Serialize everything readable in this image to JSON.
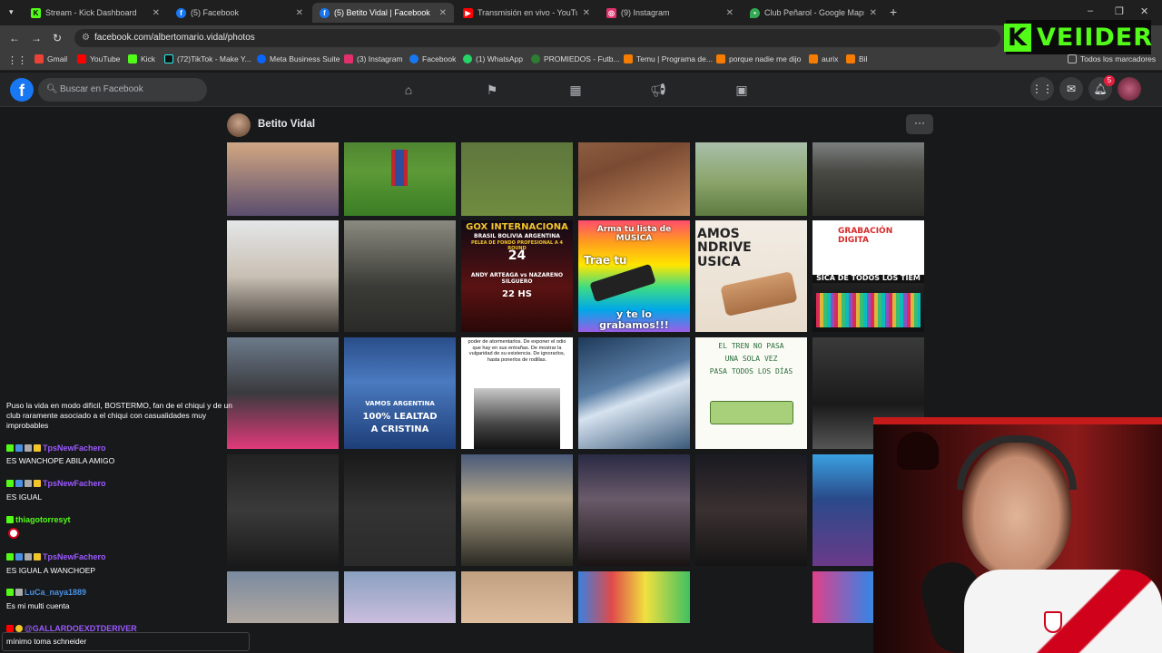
{
  "browser": {
    "tabs": [
      {
        "title": "Stream - Kick Dashboard",
        "favicon": "kick-icon",
        "color": "#53fc18",
        "active": false
      },
      {
        "title": "(5) Facebook",
        "favicon": "facebook-icon",
        "color": "#1877f2",
        "active": false
      },
      {
        "title": "(5) Betito Vidal | Facebook",
        "favicon": "facebook-icon",
        "color": "#1877f2",
        "active": true
      },
      {
        "title": "Transmisión en vivo - YouTube",
        "favicon": "youtube-icon",
        "color": "#ff0000",
        "active": false
      },
      {
        "title": "(9) Instagram",
        "favicon": "instagram-icon",
        "color": "#e1306c",
        "active": false
      },
      {
        "title": "Club Peñarol - Google Maps",
        "favicon": "maps-icon",
        "color": "#34a853",
        "active": false
      }
    ],
    "url": "facebook.com/albertomario.vidal/photos",
    "bookmarks": [
      {
        "label": "Gmail",
        "color": "#ea4335"
      },
      {
        "label": "YouTube",
        "color": "#ff0000"
      },
      {
        "label": "Kick",
        "color": "#53fc18"
      },
      {
        "label": "(72)TikTok - Make Y...",
        "color": "#25f4ee"
      },
      {
        "label": "Meta Business Suite",
        "color": "#0866ff"
      },
      {
        "label": "(3) Instagram",
        "color": "#e1306c"
      },
      {
        "label": "Facebook",
        "color": "#1877f2"
      },
      {
        "label": "(1) WhatsApp",
        "color": "#25d366"
      },
      {
        "label": "PROMIEDOS - Futb...",
        "color": "#2e7d32"
      },
      {
        "label": "Temu | Programa de...",
        "color": "#f57c00"
      },
      {
        "label": "porque nadie me dijo",
        "color": "#f57c00"
      },
      {
        "label": "aurix",
        "color": "#f57c00"
      },
      {
        "label": "Bil",
        "color": "#f57c00"
      }
    ],
    "all_bookmarks_label": "Todos los marcadores"
  },
  "kick_logo": "VEIIDER",
  "facebook": {
    "search_placeholder": "Buscar en Facebook",
    "notification_count": "5",
    "profile_name": "Betito Vidal",
    "photo_captions": {
      "boxing_title": "GOX INTERNACIONA",
      "boxing_sub": "BRASIL BOLIVIA ARGENTINA",
      "boxing_fight": "PELEA DE FONDO PROFESIONAL A 4 ROUND",
      "boxing_day": "24",
      "boxing_names": "ANDY ARTEAGA vs NAZARENO SILGUERO",
      "boxing_time": "22 HS",
      "music_title": "Arma tu lista de MUSICA",
      "music_trae": "Trae tu",
      "music_grab": "y te lo grabamos!!!",
      "pendrive_title": "AMOS NDRIVE USICA",
      "digital_title": "GRABACIÓN DIGITA",
      "digital_sub": "SICA DE TODOS LOS TIEM",
      "cristina_1": "VAMOS ARGENTINA",
      "cristina_2": "100% LEALTAD",
      "cristina_3": "A CRISTINA",
      "quote": "poder de atormentarlos. De exponer el odio que hay en sus entrañas. De mostrar la vulgaridad de su existencia. De ignorarlos, hasta ponerlos de rodillas.",
      "train_1": "EL TREN NO PASA",
      "train_2": "UNA SOLA VEZ",
      "train_3": "PASA TODOS LOS DÍAS"
    }
  },
  "chat": [
    {
      "type": "text",
      "text": "Puso la vida en modo difícil, BOSTERMO, fan de el chiqui y de un"
    },
    {
      "type": "text",
      "text": "club raramente asociado a el chiqui con casualidades muy"
    },
    {
      "type": "text",
      "text": "improbables"
    },
    {
      "type": "user",
      "name": "TpsNewFachero",
      "color": "#9b59ff"
    },
    {
      "type": "text",
      "text": "ES WANCHOPE ABILA AMIGO"
    },
    {
      "type": "user",
      "name": "TpsNewFachero",
      "color": "#9b59ff"
    },
    {
      "type": "text",
      "text": "ES IGUAL"
    },
    {
      "type": "user",
      "name": "thiagotorresyt",
      "color": "#53fc18"
    },
    {
      "type": "user",
      "name": "TpsNewFachero",
      "color": "#9b59ff"
    },
    {
      "type": "text",
      "text": "ES IGUAL A WANCHOEP"
    },
    {
      "type": "user",
      "name": "LuCa_naya1889",
      "color": "#4a90e2"
    },
    {
      "type": "text",
      "text": "Es mi multi cuenta"
    },
    {
      "type": "user",
      "name": "@GALLARDOEXDTDERIVER",
      "color": "#9b59ff"
    },
    {
      "type": "text",
      "text": "mínimo toma schneider"
    }
  ]
}
